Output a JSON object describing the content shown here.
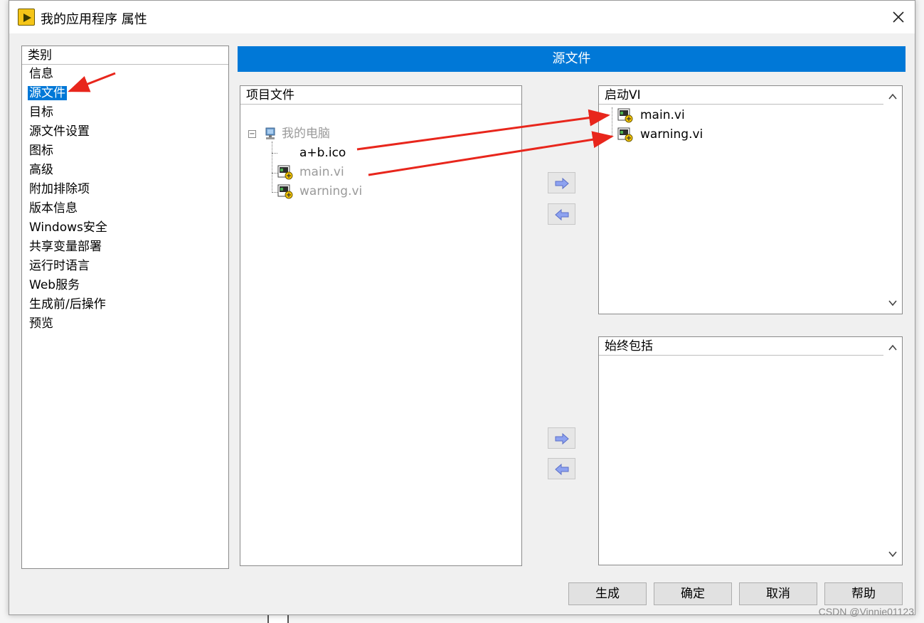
{
  "window": {
    "title": "我的应用程序 属性"
  },
  "category": {
    "header": "类别",
    "items": [
      "信息",
      "源文件",
      "目标",
      "源文件设置",
      "图标",
      "高级",
      "附加排除项",
      "版本信息",
      "Windows安全",
      "共享变量部署",
      "运行时语言",
      "Web服务",
      "生成前/后操作",
      "预览"
    ],
    "selected": "源文件"
  },
  "section": {
    "title": "源文件"
  },
  "project_files": {
    "header": "项目文件",
    "tree": {
      "root": "我的电脑",
      "children": [
        "a+b.ico",
        "main.vi",
        "warning.vi"
      ]
    }
  },
  "startup_vis": {
    "header": "启动VI",
    "items": [
      "main.vi",
      "warning.vi"
    ]
  },
  "always_included": {
    "header": "始终包括",
    "items": []
  },
  "buttons": {
    "build": "生成",
    "ok": "确定",
    "cancel": "取消",
    "help": "帮助"
  },
  "watermark": "CSDN @Vinnie01123",
  "colors": {
    "accent": "#0078d7",
    "annotation": "#e8261c"
  }
}
